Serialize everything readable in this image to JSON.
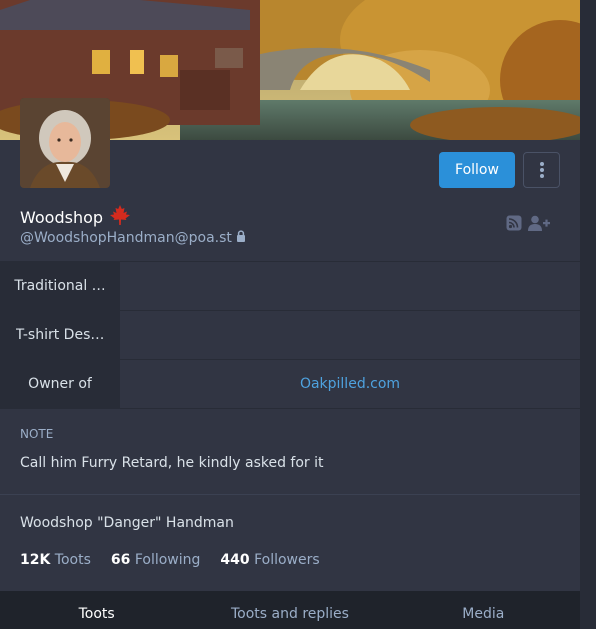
{
  "profile": {
    "display_name": "Woodshop",
    "flag_icon": "maple-leaf-icon",
    "handle": "@WoodshopHandman@poa.st",
    "locked_icon": "lock-icon",
    "follow_label": "Follow",
    "full_name": "Woodshop \"Danger\" Handman"
  },
  "fields": [
    {
      "name": "Traditional …",
      "value": ""
    },
    {
      "name": "T-shirt Des…",
      "value": ""
    },
    {
      "name": "Owner of",
      "value": "Oakpilled.com"
    }
  ],
  "note": {
    "label": "Note",
    "text": "Call him Furry Retard, he kindly asked for it"
  },
  "counts": {
    "toots_num": "12K",
    "toots_label": "Toots",
    "following_num": "66",
    "following_label": "Following",
    "followers_num": "440",
    "followers_label": "Followers"
  },
  "tabs": [
    {
      "label": "Toots"
    },
    {
      "label": "Toots and replies"
    },
    {
      "label": "Media"
    }
  ],
  "colors": {
    "accent": "#2b90d9",
    "link": "#4ea2df",
    "background": "#313543"
  }
}
